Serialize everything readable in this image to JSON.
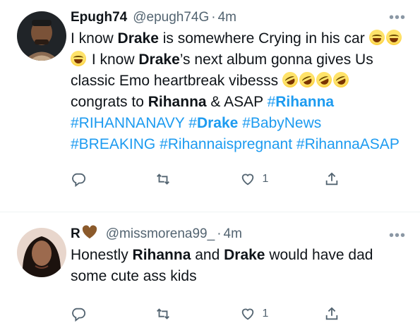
{
  "tweets": [
    {
      "name": "Epugh74",
      "handle": "@epugh74G",
      "separator": "·",
      "time": "4m",
      "more": "•••",
      "body": [
        {
          "t": "I know "
        },
        {
          "b": "Drake"
        },
        {
          "t": " is somewhere Crying in his car "
        },
        {
          "e": "laugh"
        },
        {
          "e": "laugh"
        },
        {
          "e": "laugh"
        },
        {
          "t": " I know "
        },
        {
          "b": "Drake"
        },
        {
          "t": "’s next album gonna gives Us classic Emo heartbreak vibesss "
        },
        {
          "e": "rofl"
        },
        {
          "e": "rofl"
        },
        {
          "e": "rofl"
        },
        {
          "e": "rofl"
        },
        {
          "t": " congrats to "
        },
        {
          "b": "Rihanna"
        },
        {
          "t": " & ASAP "
        },
        {
          "h": "#",
          "hb": "Rihanna"
        },
        {
          "t": " "
        },
        {
          "h": "#RIHANNANAVY"
        },
        {
          "t": " "
        },
        {
          "h": "#",
          "hb": "Drake"
        },
        {
          "t": " "
        },
        {
          "h": "#BabyNews"
        },
        {
          "t": " "
        },
        {
          "h": "#BREAKING"
        },
        {
          "t": " "
        },
        {
          "h": "#Rihannaispregnant"
        },
        {
          "t": " "
        },
        {
          "h": "#RihannaASAP"
        }
      ],
      "actions": {
        "reply": "",
        "retweet": "",
        "like_count": "1",
        "share": ""
      }
    },
    {
      "name": "R",
      "name_emoji": "brown-heart",
      "handle": "@missmorena99_",
      "separator": "·",
      "time": "4m",
      "more": "•••",
      "body": [
        {
          "t": "Honestly "
        },
        {
          "b": "Rihanna"
        },
        {
          "t": " and "
        },
        {
          "b": "Drake"
        },
        {
          "t": " would have dad some cute ass kids"
        }
      ],
      "actions": {
        "reply": "",
        "retweet": "",
        "like_count": "1",
        "share": ""
      }
    }
  ],
  "icons": {
    "reply": "reply-icon",
    "retweet": "retweet-icon",
    "like": "heart-icon",
    "share": "share-icon",
    "more": "more-icon"
  },
  "colors": {
    "hashtag": "#1d9bf0",
    "secondary": "#536471",
    "heart": "#8b5a2b"
  }
}
